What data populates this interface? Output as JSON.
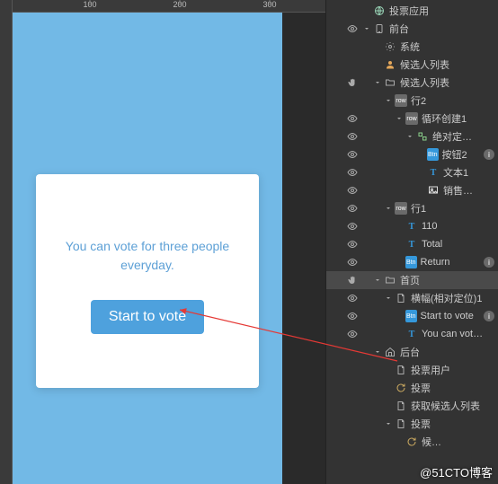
{
  "ruler": {
    "t100": "100",
    "t200": "200",
    "t300": "300"
  },
  "card": {
    "text_line1": "You can vote for three people",
    "text_line2": "everyday.",
    "button": "Start to vote"
  },
  "tree": [
    {
      "depth": 0,
      "eye": 0,
      "hand": 0,
      "caret": "",
      "icon": "glob",
      "label": "投票应用",
      "sel": 0,
      "info": 0
    },
    {
      "depth": 0,
      "eye": 1,
      "hand": 0,
      "caret": "down",
      "icon": "device",
      "label": "前台",
      "sel": 0,
      "info": 0
    },
    {
      "depth": 1,
      "eye": 0,
      "hand": 0,
      "caret": "",
      "icon": "gear",
      "label": "系统",
      "sel": 0,
      "info": 0
    },
    {
      "depth": 1,
      "eye": 0,
      "hand": 0,
      "caret": "",
      "icon": "user",
      "label": "候选人列表",
      "sel": 0,
      "info": 0
    },
    {
      "depth": 1,
      "eye": 0,
      "hand": 1,
      "caret": "down",
      "icon": "folder",
      "label": "候选人列表",
      "sel": 0,
      "info": 0
    },
    {
      "depth": 2,
      "eye": 0,
      "hand": 0,
      "caret": "down",
      "icon": "loop",
      "label": "行2",
      "sel": 0,
      "info": 0
    },
    {
      "depth": 3,
      "eye": 1,
      "hand": 0,
      "caret": "down",
      "icon": "loop",
      "label": "循环创建1",
      "sel": 0,
      "info": 0
    },
    {
      "depth": 4,
      "eye": 1,
      "hand": 0,
      "caret": "down",
      "icon": "abs",
      "label": "绝对定…",
      "sel": 0,
      "info": 0
    },
    {
      "depth": 5,
      "eye": 1,
      "hand": 0,
      "caret": "",
      "icon": "btn",
      "label": "按钮2",
      "sel": 0,
      "info": 1
    },
    {
      "depth": 5,
      "eye": 1,
      "hand": 0,
      "caret": "",
      "icon": "txt",
      "label": "文本1",
      "sel": 0,
      "info": 0
    },
    {
      "depth": 5,
      "eye": 1,
      "hand": 0,
      "caret": "",
      "icon": "img",
      "label": "销售…",
      "sel": 0,
      "info": 0
    },
    {
      "depth": 2,
      "eye": 1,
      "hand": 0,
      "caret": "down",
      "icon": "loop",
      "label": "行1",
      "sel": 0,
      "info": 0
    },
    {
      "depth": 3,
      "eye": 1,
      "hand": 0,
      "caret": "",
      "icon": "txt",
      "label": "110",
      "sel": 0,
      "info": 0
    },
    {
      "depth": 3,
      "eye": 1,
      "hand": 0,
      "caret": "",
      "icon": "txt",
      "label": "Total",
      "sel": 0,
      "info": 0
    },
    {
      "depth": 3,
      "eye": 1,
      "hand": 0,
      "caret": "",
      "icon": "btn",
      "label": "Return",
      "sel": 0,
      "info": 1
    },
    {
      "depth": 1,
      "eye": 0,
      "hand": 1,
      "caret": "down",
      "icon": "folder",
      "label": "首页",
      "sel": 1,
      "info": 0
    },
    {
      "depth": 2,
      "eye": 1,
      "hand": 0,
      "caret": "down",
      "icon": "doc",
      "label": "横幅(相对定位)1",
      "sel": 0,
      "info": 0
    },
    {
      "depth": 3,
      "eye": 1,
      "hand": 0,
      "caret": "",
      "icon": "btn",
      "label": "Start to vote",
      "sel": 0,
      "info": 1
    },
    {
      "depth": 3,
      "eye": 1,
      "hand": 0,
      "caret": "",
      "icon": "txt",
      "label": "You can vot…",
      "sel": 0,
      "info": 0
    },
    {
      "depth": 1,
      "eye": 0,
      "hand": 0,
      "caret": "down",
      "icon": "home",
      "label": "后台",
      "sel": 0,
      "info": 0
    },
    {
      "depth": 2,
      "eye": 0,
      "hand": 0,
      "caret": "",
      "icon": "doc",
      "label": "投票用户",
      "sel": 0,
      "info": 0
    },
    {
      "depth": 2,
      "eye": 0,
      "hand": 0,
      "caret": "",
      "icon": "refresh",
      "label": "投票",
      "sel": 0,
      "info": 0
    },
    {
      "depth": 2,
      "eye": 0,
      "hand": 0,
      "caret": "",
      "icon": "doc",
      "label": "获取候选人列表",
      "sel": 0,
      "info": 0
    },
    {
      "depth": 2,
      "eye": 0,
      "hand": 0,
      "caret": "down",
      "icon": "doc",
      "label": "投票",
      "sel": 0,
      "info": 0
    },
    {
      "depth": 3,
      "eye": 0,
      "hand": 0,
      "caret": "",
      "icon": "refresh",
      "label": "候…",
      "sel": 0,
      "info": 0
    }
  ],
  "watermark": "@51CTO博客"
}
